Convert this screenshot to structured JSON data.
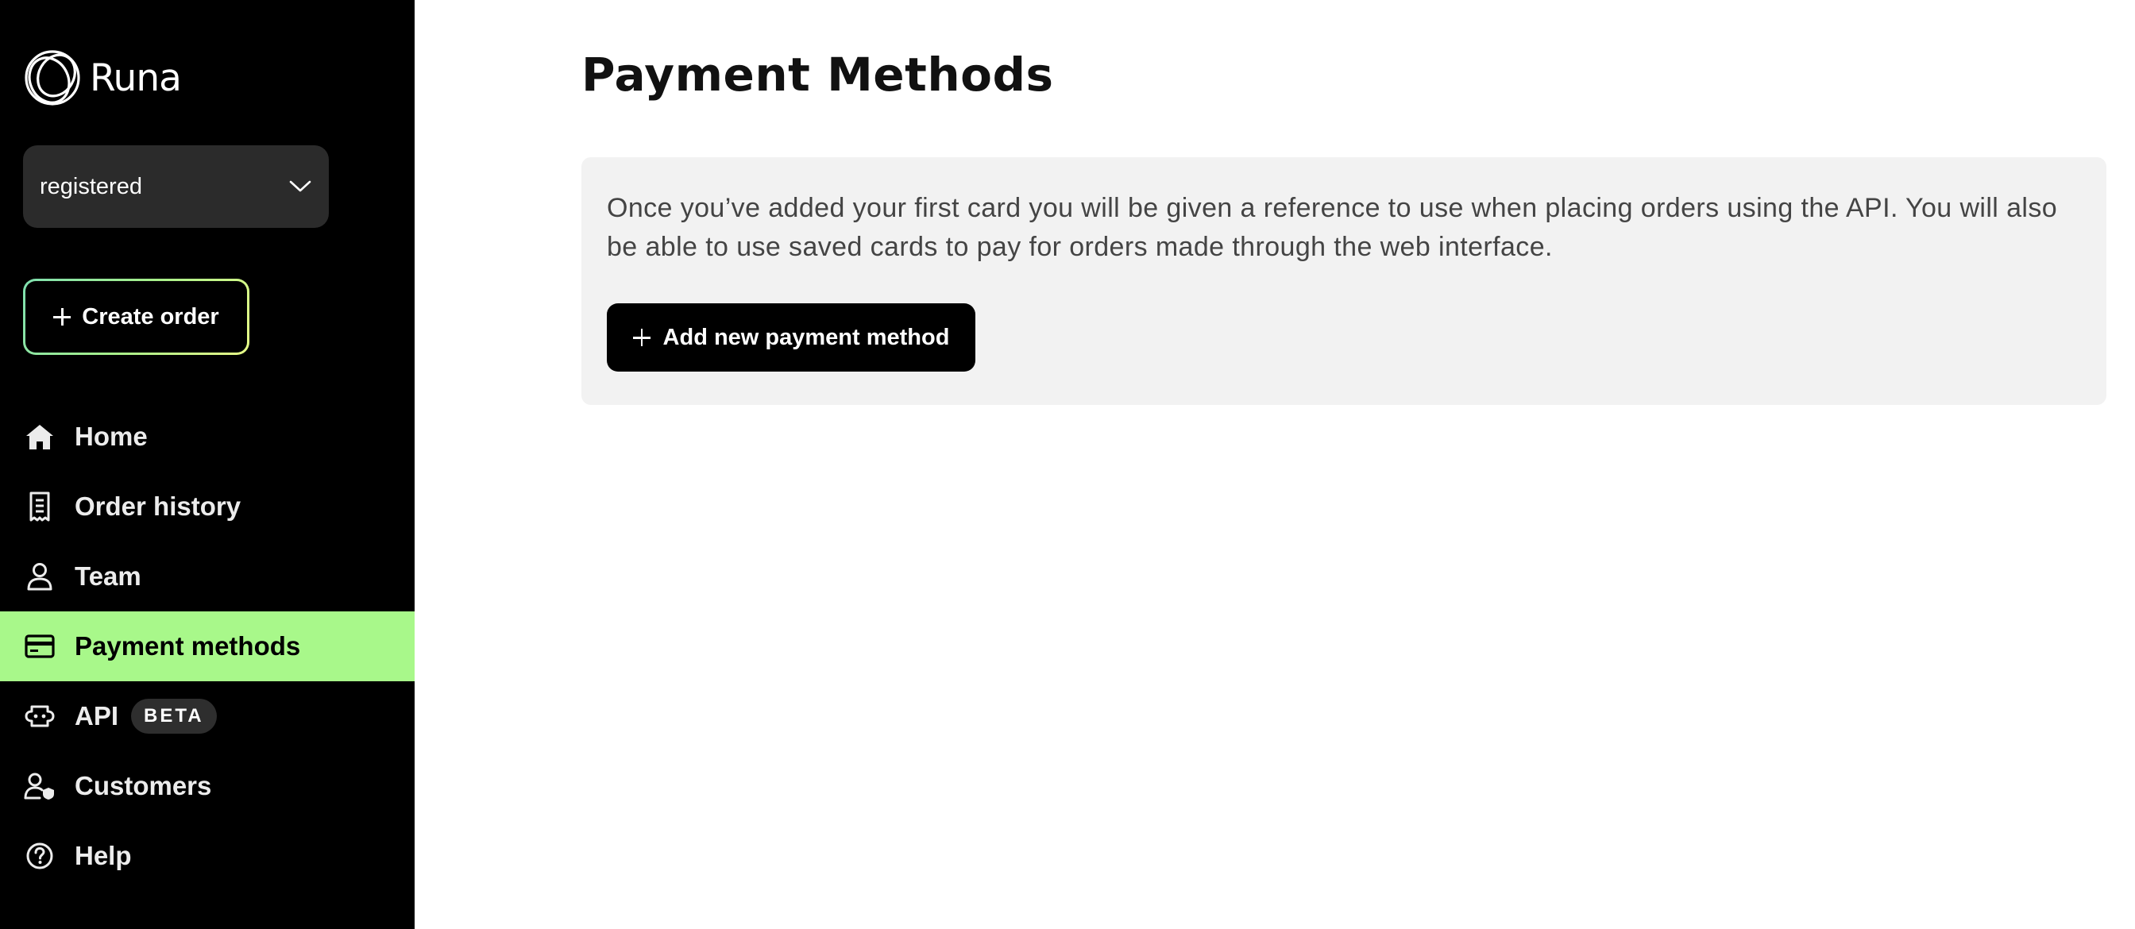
{
  "brand": {
    "name": "Runa"
  },
  "account_selector": {
    "value": "registered",
    "icon": "chevron-down-icon"
  },
  "sidebar": {
    "create_order_label": "Create order",
    "items": [
      {
        "label": "Home",
        "icon": "home-icon",
        "active": false
      },
      {
        "label": "Order history",
        "icon": "receipt-icon",
        "active": false
      },
      {
        "label": "Team",
        "icon": "user-icon",
        "active": false
      },
      {
        "label": "Payment methods",
        "icon": "credit-card-icon",
        "active": true
      },
      {
        "label": "API",
        "icon": "api-icon",
        "active": false,
        "badge": "BETA"
      },
      {
        "label": "Customers",
        "icon": "customers-icon",
        "active": false
      },
      {
        "label": "Help",
        "icon": "help-icon",
        "active": false
      }
    ]
  },
  "main": {
    "title": "Payment Methods",
    "info_text": "Once you’ve added your first card you will be given a reference to use when placing orders using the API. You will also be able to use saved cards to pay for orders made through the web interface.",
    "add_button_label": "Add new payment method"
  },
  "colors": {
    "sidebar_bg": "#000000",
    "active_nav_bg": "#a8f88a",
    "card_bg": "#f2f2f2",
    "button_bg": "#000000",
    "gradient_border": [
      "#7fe0b0",
      "#a8f08a",
      "#e8ff88"
    ]
  }
}
